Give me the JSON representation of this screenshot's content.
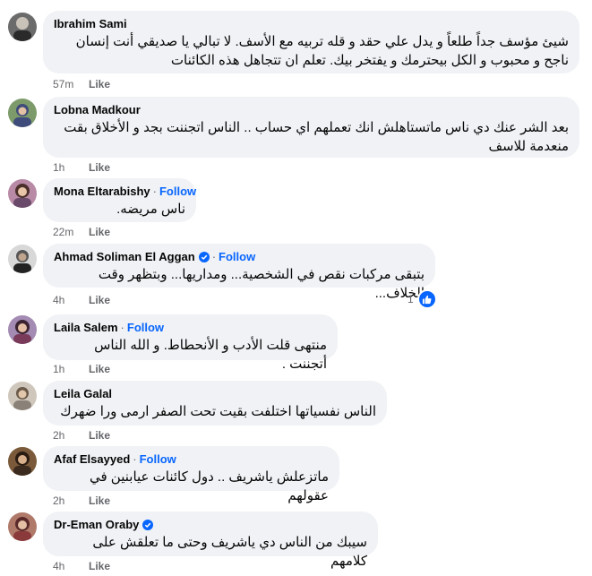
{
  "comments": [
    {
      "name": "Ibrahim Sami",
      "follow": "",
      "verified": false,
      "lines": [
        "شيئ مؤسف جداً طلعاً و يدل علي حقد و قله تربيه مع الأسف. لا تبالي يا صديقي أنت إنسان",
        "ناجح و محبوب و الكل بيحترمك و يفتخر بيك. تعلم ان تتجاهل هذه الكائنات"
      ],
      "time": "57m",
      "like": "Like"
    },
    {
      "name": "Lobna Madkour",
      "follow": "",
      "verified": false,
      "lines": [
        "بعد الشر عنك دي ناس ماتستاهلش انك تعملهم اي حساب .. الناس اتجننت بجد و الأخلاق بقت",
        "منعدمة للاسف"
      ],
      "time": "1h",
      "like": "Like"
    },
    {
      "name": "Mona Eltarabishy",
      "follow": "Follow",
      "verified": false,
      "lines": [
        "ناس مريضه."
      ],
      "time": "22m",
      "like": "Like"
    },
    {
      "name": "Ahmad Soliman El Aggan",
      "follow": "Follow",
      "verified": true,
      "lines": [
        "بتبقى مركبات نقص في الشخصية... ومداريها... وبتظهر وقت الخلاف..."
      ],
      "time": "4h",
      "like": "Like",
      "reactions": "1"
    },
    {
      "name": "Laila Salem",
      "follow": "Follow",
      "verified": false,
      "lines": [
        "منتهى قلت الأدب و الأنحطاط. و الله الناس أتجننت ."
      ],
      "time": "1h",
      "like": "Like"
    },
    {
      "name": "Leila Galal",
      "follow": "",
      "verified": false,
      "lines": [
        "الناس نفسياتها اختلفت بقيت تحت الصفر ارمى ورا ضهرك"
      ],
      "time": "2h",
      "like": "Like"
    },
    {
      "name": "Afaf Elsayyed",
      "follow": "Follow",
      "verified": false,
      "lines": [
        "ماتزعلش ياشريف .. دول كائنات عيابنين في عقولهم"
      ],
      "time": "2h",
      "like": "Like"
    },
    {
      "name": "Dr-Eman Oraby",
      "follow": "",
      "verified": true,
      "lines": [
        "سيبك من الناس دي ياشريف وحتى ما تعلقش على كلامهم"
      ],
      "time": "4h",
      "like": "Like"
    }
  ],
  "colors": {
    "bubble": "#f0f2f5",
    "follow": "#0866ff",
    "meta": "#65676b",
    "text": "#050505"
  }
}
